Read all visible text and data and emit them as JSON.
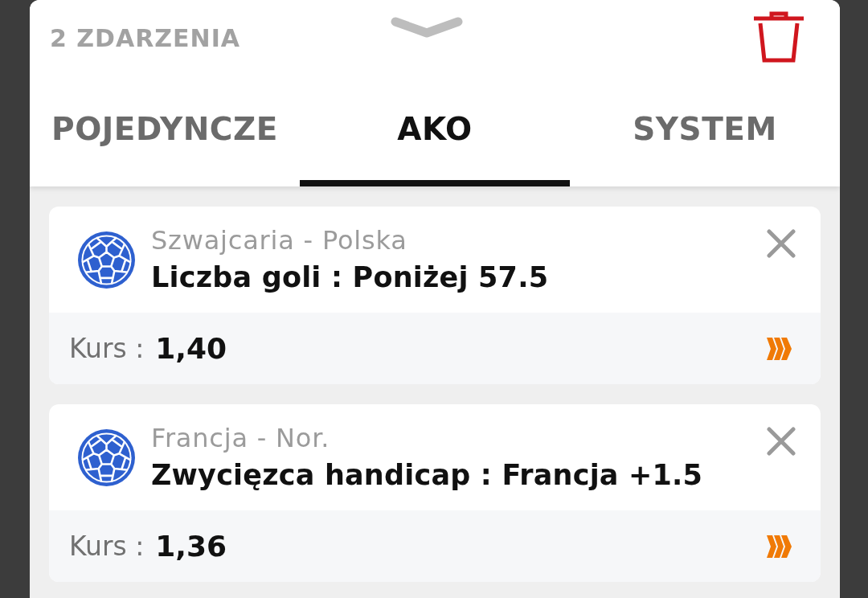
{
  "header": {
    "title": "2 ZDARZENIA"
  },
  "tabs": [
    {
      "label": "POJEDYNCZE",
      "selected": false
    },
    {
      "label": "AKO",
      "selected": true
    },
    {
      "label": "SYSTEM",
      "selected": false
    }
  ],
  "bets": [
    {
      "match": "Szwajcaria - Polska",
      "selection": "Liczba goli : Poniżej 57.5",
      "odds_label": "Kurs :",
      "odds": "1,40"
    },
    {
      "match": "Francja - Nor.",
      "selection": "Zwycięzca handicap : Francja +1.5",
      "odds_label": "Kurs :",
      "odds": "1,36"
    }
  ]
}
